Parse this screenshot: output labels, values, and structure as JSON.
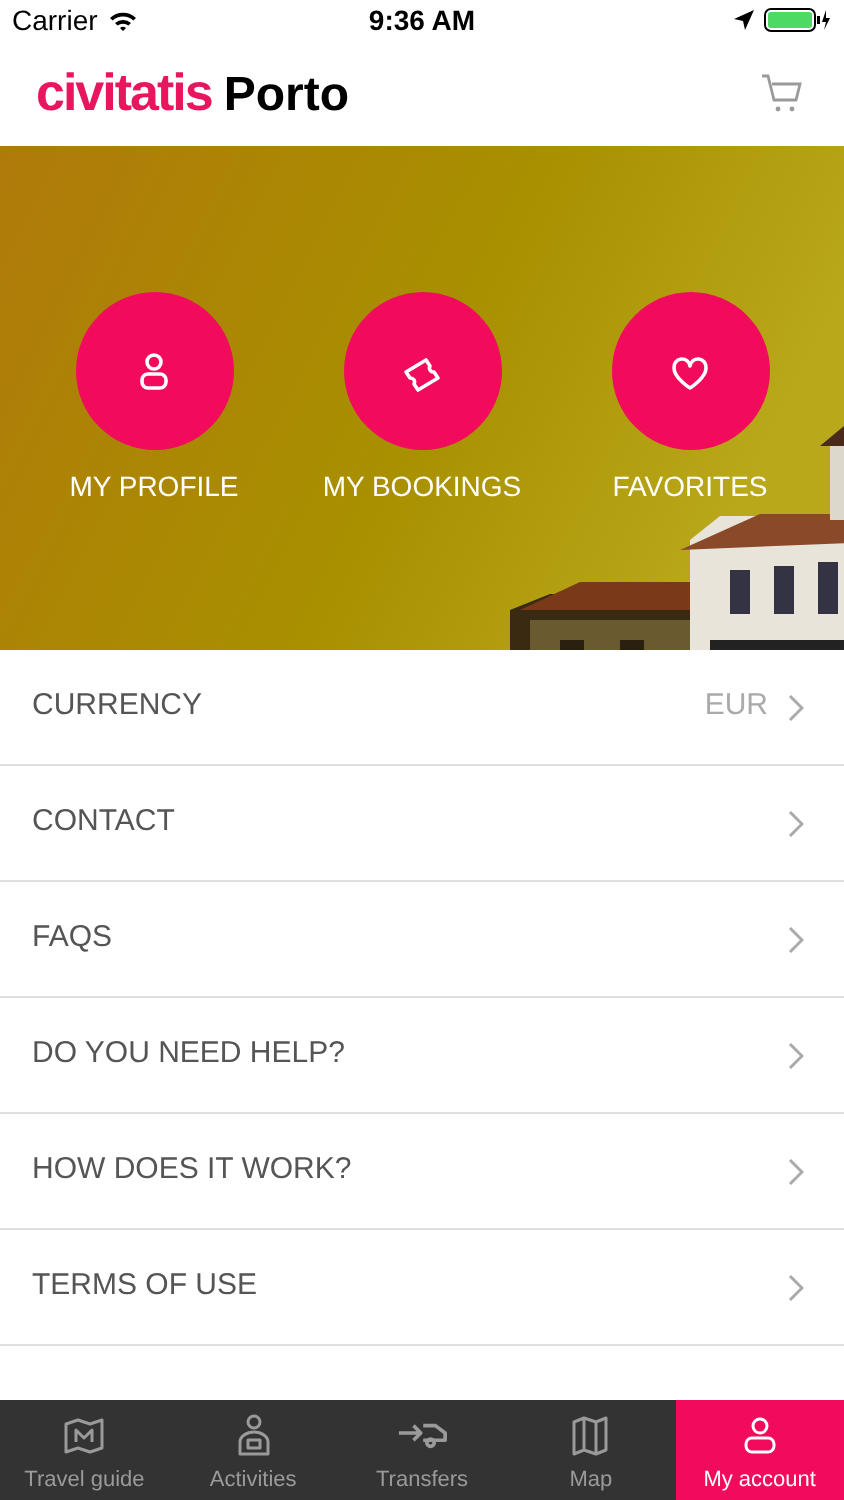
{
  "status_bar": {
    "carrier": "Carrier",
    "time": "9:36 AM"
  },
  "header": {
    "brand": "civitatis",
    "city": "Porto"
  },
  "shortcuts": [
    {
      "kind": "profile",
      "label": "MY PROFILE"
    },
    {
      "kind": "bookings",
      "label": "MY BOOKINGS"
    },
    {
      "kind": "favorites",
      "label": "FAVORITES"
    }
  ],
  "menu": [
    {
      "label": "CURRENCY",
      "value": "EUR"
    },
    {
      "label": "CONTACT"
    },
    {
      "label": "FAQS"
    },
    {
      "label": "DO YOU NEED HELP?"
    },
    {
      "label": "HOW DOES IT WORK?"
    },
    {
      "label": "TERMS OF USE"
    }
  ],
  "tab_bar": [
    {
      "kind": "guide",
      "label": "Travel guide",
      "selected": false
    },
    {
      "kind": "activities",
      "label": "Activities",
      "selected": false
    },
    {
      "kind": "transfers",
      "label": "Transfers",
      "selected": false
    },
    {
      "kind": "map",
      "label": "Map",
      "selected": false
    },
    {
      "kind": "account",
      "label": "My account",
      "selected": true
    }
  ]
}
